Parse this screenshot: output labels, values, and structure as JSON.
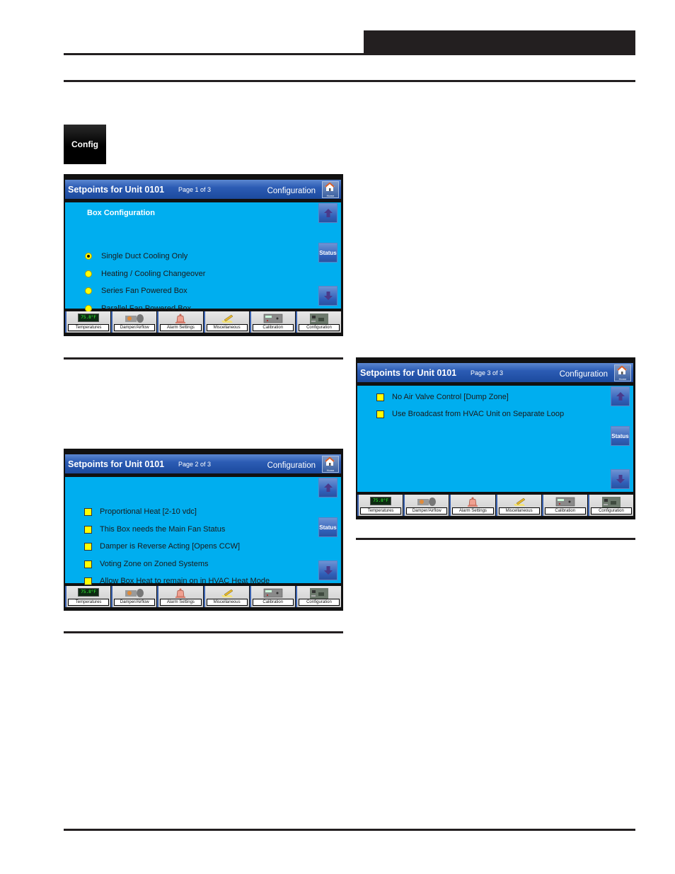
{
  "config_button": {
    "label": "Config"
  },
  "screens": [
    {
      "title": "Setpoints for Unit 0101",
      "page": "Page 1 of 3",
      "section": "Configuration",
      "home_label": "Home",
      "heading": "Box Configuration",
      "item_type": "radio",
      "items": [
        {
          "label": "Single Duct Cooling Only",
          "selected": true
        },
        {
          "label": "Heating / Cooling Changeover",
          "selected": false
        },
        {
          "label": "Series Fan Powered Box",
          "selected": false
        },
        {
          "label": "Parallel Fan Powered Box",
          "selected": false
        }
      ]
    },
    {
      "title": "Setpoints for Unit 0101",
      "page": "Page 2 of 3",
      "section": "Configuration",
      "home_label": "Home",
      "heading": "",
      "item_type": "checkbox",
      "items": [
        {
          "label": "Proportional Heat [2-10 vdc]",
          "checked": false
        },
        {
          "label": "This Box needs the Main Fan Status",
          "checked": false
        },
        {
          "label": "Damper is Reverse Acting [Opens CCW]",
          "checked": false
        },
        {
          "label": "Voting Zone on Zoned Systems",
          "checked": false
        },
        {
          "label": "Allow Box Heat to remain on in HVAC Heat Mode",
          "checked": false
        }
      ]
    },
    {
      "title": "Setpoints for Unit 0101",
      "page": "Page 3 of 3",
      "section": "Configuration",
      "home_label": "Home",
      "heading": "",
      "item_type": "checkbox",
      "items": [
        {
          "label": "No Air Valve Control [Dump Zone]",
          "checked": false
        },
        {
          "label": "Use Broadcast from HVAC Unit on Separate Loop",
          "checked": false
        }
      ]
    }
  ],
  "nav": {
    "up_icon": "arrow-up-icon",
    "status_label": "Status",
    "down_icon": "arrow-down-icon"
  },
  "toolbar": [
    {
      "label": "Temperatures",
      "icon": "lcd-display-icon",
      "lcd_text": "75.8°F"
    },
    {
      "label": "Damper/Airflow",
      "icon": "damper-icon"
    },
    {
      "label": "Alarm Settings",
      "icon": "bell-icon"
    },
    {
      "label": "Miscellaneous",
      "icon": "pencil-note-icon"
    },
    {
      "label": "Calibration",
      "icon": "controller-icon"
    },
    {
      "label": "Configuration",
      "icon": "circuit-board-icon"
    }
  ],
  "colors": {
    "content_bg": "#00aeef",
    "titlebar": "#2c5cb4",
    "indicator": "#ffff00",
    "rule": "#231f20"
  }
}
